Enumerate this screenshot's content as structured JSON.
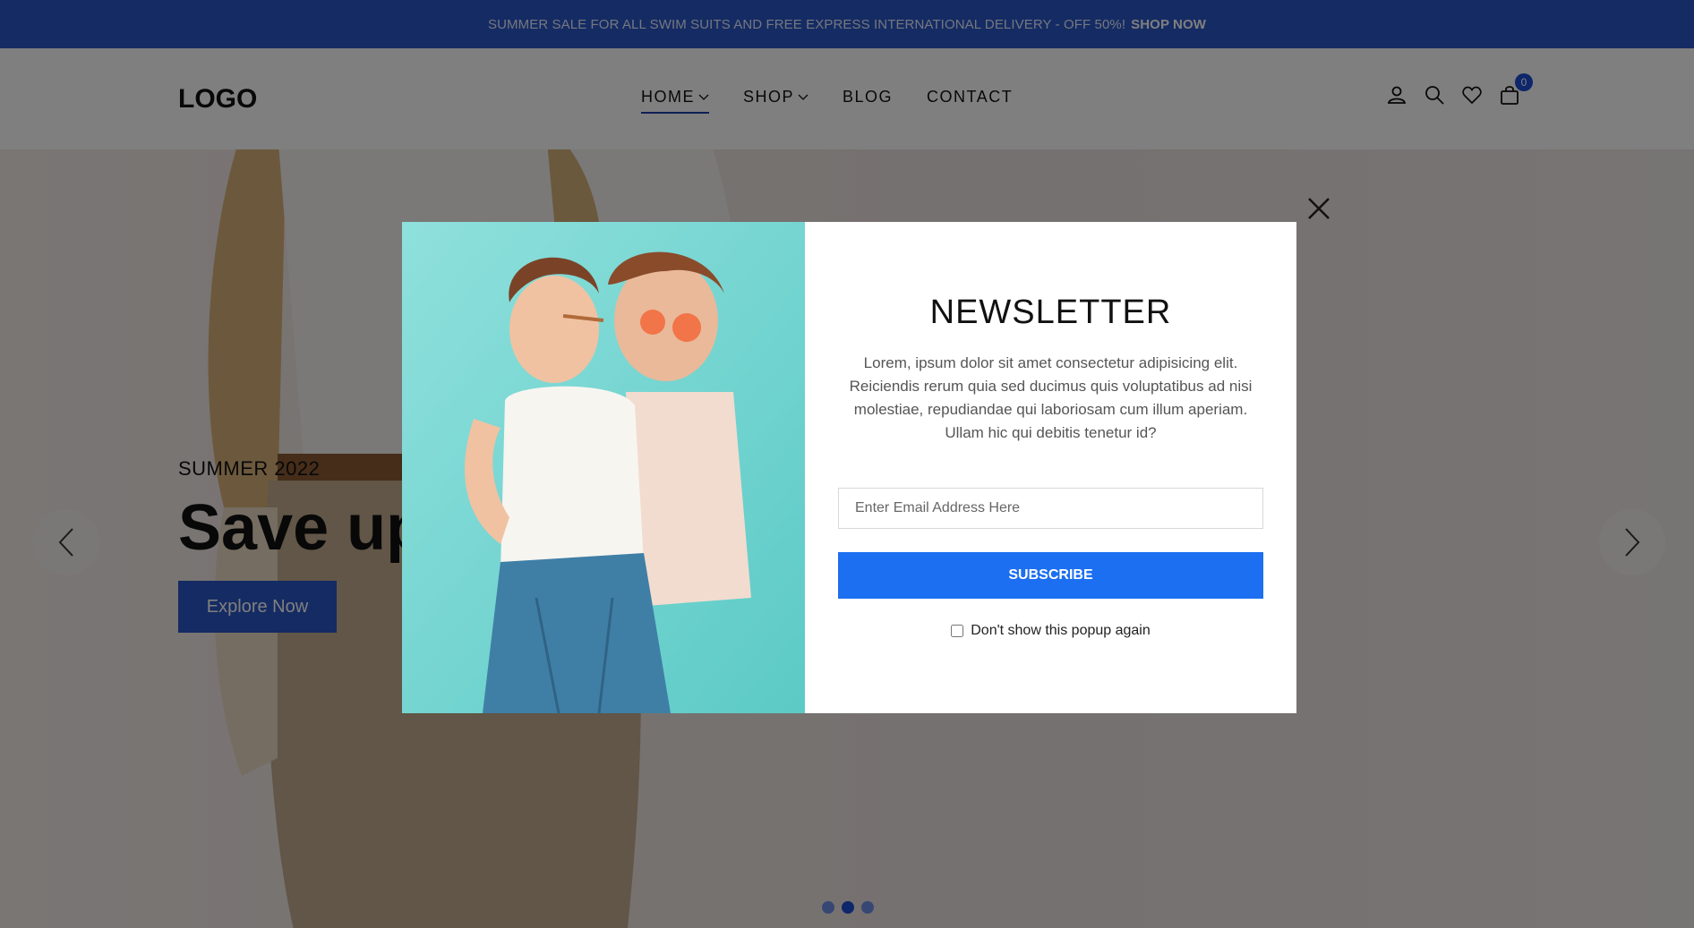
{
  "announcement": {
    "text": "SUMMER SALE FOR ALL SWIM SUITS AND FREE EXPRESS INTERNATIONAL DELIVERY - OFF 50%!",
    "link": "SHOP NOW"
  },
  "header": {
    "logo": "LOGO",
    "nav": [
      {
        "label": "HOME",
        "active": true,
        "dropdown": true
      },
      {
        "label": "SHOP",
        "active": false,
        "dropdown": true
      },
      {
        "label": "BLOG",
        "active": false,
        "dropdown": false
      },
      {
        "label": "CONTACT",
        "active": false,
        "dropdown": false
      }
    ],
    "icons": [
      "user-icon",
      "search-icon",
      "heart-icon",
      "cart-icon"
    ],
    "cart_count": "0"
  },
  "hero": {
    "subtitle": "SUMMER 2022",
    "title": "Save up",
    "button": "Explore Now",
    "slides": 3,
    "active_slide": 2
  },
  "modal": {
    "title": "NEWSLETTER",
    "text": "Lorem, ipsum dolor sit amet consectetur adipisicing elit. Reiciendis rerum quia sed ducimus quis voluptatibus ad nisi molestiae, repudiandae qui laboriosam cum illum aperiam. Ullam hic qui debitis tenetur id?",
    "email_placeholder": "Enter Email Address Here",
    "subscribe_label": "SUBSCRIBE",
    "dont_show_label": "Don't show this popup again"
  },
  "colors": {
    "brand": "#2a56c6",
    "accent": "#1c6ff0"
  }
}
